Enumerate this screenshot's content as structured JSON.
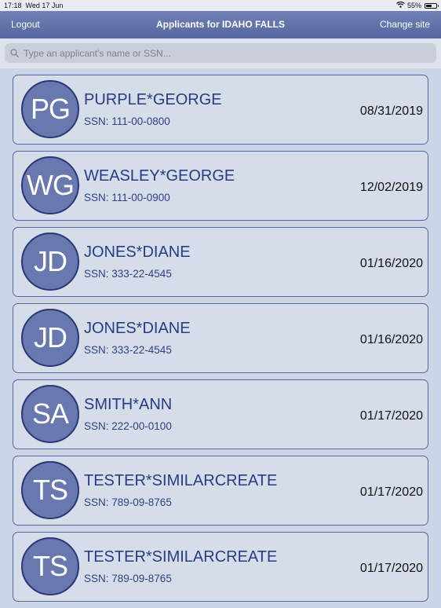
{
  "status_bar": {
    "time": "17:18",
    "date": "Wed 17 Jun",
    "battery_text": "55%",
    "battery_level": 0.55
  },
  "nav": {
    "left_label": "Logout",
    "title": "Applicants for IDAHO FALLS",
    "right_label": "Change site"
  },
  "search": {
    "placeholder": "Type an applicant's name or SSN...",
    "value": ""
  },
  "applicants": [
    {
      "initials": "PG",
      "name": "PURPLE*GEORGE",
      "ssn": "SSN: 111-00-0800",
      "date": "08/31/2019"
    },
    {
      "initials": "WG",
      "name": "WEASLEY*GEORGE",
      "ssn": "SSN: 111-00-0900",
      "date": "12/02/2019"
    },
    {
      "initials": "JD",
      "name": "JONES*DIANE",
      "ssn": "SSN: 333-22-4545",
      "date": "01/16/2020"
    },
    {
      "initials": "JD",
      "name": "JONES*DIANE",
      "ssn": "SSN: 333-22-4545",
      "date": "01/16/2020"
    },
    {
      "initials": "SA",
      "name": "SMITH*ANN",
      "ssn": "SSN: 222-00-0100",
      "date": "01/17/2020"
    },
    {
      "initials": "TS",
      "name": "TESTER*SIMILARCREATE",
      "ssn": "SSN: 789-09-8765",
      "date": "01/17/2020"
    },
    {
      "initials": "TS",
      "name": "TESTER*SIMILARCREATE",
      "ssn": "SSN: 789-09-8765",
      "date": "01/17/2020"
    }
  ]
}
